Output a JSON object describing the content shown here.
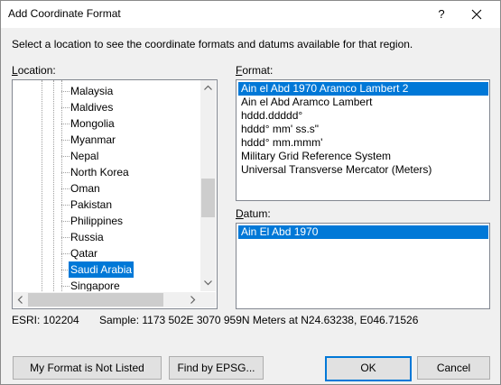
{
  "window": {
    "title": "Add Coordinate Format",
    "help_label": "?"
  },
  "instruction": "Select a location to see the coordinate formats and datums available for that region.",
  "location": {
    "label": "Location:",
    "items": [
      "Malaysia",
      "Maldives",
      "Mongolia",
      "Myanmar",
      "Nepal",
      "North Korea",
      "Oman",
      "Pakistan",
      "Philippines",
      "Russia",
      "Qatar",
      "Saudi Arabia",
      "Singapore"
    ],
    "selected": "Saudi Arabia"
  },
  "format": {
    "label": "Format:",
    "items": [
      "Ain el Abd 1970 Aramco Lambert 2",
      "Ain el Abd Aramco Lambert",
      "hddd.ddddd°",
      "hddd° mm' ss.s\"",
      "hddd° mm.mmm'",
      "Military Grid Reference System",
      "Universal Transverse Mercator (Meters)"
    ],
    "selected": "Ain el Abd 1970 Aramco Lambert 2"
  },
  "datum": {
    "label": "Datum:",
    "items": [
      "Ain El Abd 1970"
    ],
    "selected": "Ain El Abd 1970"
  },
  "status": {
    "esri": "ESRI: 102204",
    "sample": "Sample: 1173 502E  3070 959N Meters at N24.63238, E046.71526"
  },
  "buttons": {
    "not_listed": "My Format is Not Listed",
    "find_epsg": "Find by EPSG...",
    "ok": "OK",
    "cancel": "Cancel"
  },
  "colors": {
    "selection": "#0078d7",
    "dialog_bg": "#f0f0f0"
  }
}
